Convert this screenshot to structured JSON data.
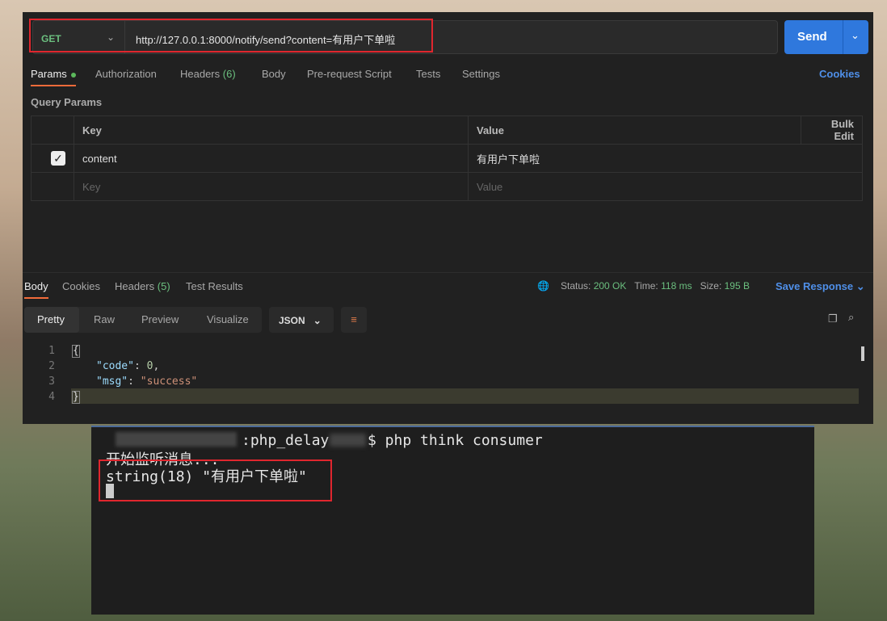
{
  "request": {
    "method": "GET",
    "url": "http://127.0.0.1:8000/notify/send?content=有用户下单啦",
    "send_label": "Send"
  },
  "tabs": [
    {
      "label": "Params"
    },
    {
      "label": "Authorization"
    },
    {
      "label": "Headers",
      "count": "(6)"
    },
    {
      "label": "Body"
    },
    {
      "label": "Pre-request Script"
    },
    {
      "label": "Tests"
    },
    {
      "label": "Settings"
    }
  ],
  "cookies_link": "Cookies",
  "query_params": {
    "title": "Query Params",
    "col_key": "Key",
    "col_value": "Value",
    "bulk_edit": "Bulk Edit",
    "rows": [
      {
        "checked": true,
        "key": "content",
        "value": "有用户下单啦"
      }
    ],
    "key_placeholder": "Key",
    "value_placeholder": "Value"
  },
  "response": {
    "tabs": [
      {
        "label": "Body"
      },
      {
        "label": "Cookies"
      },
      {
        "label": "Headers",
        "count": "(5)"
      },
      {
        "label": "Test Results"
      }
    ],
    "status_label": "Status:",
    "status": "200 OK",
    "time_label": "Time:",
    "time": "118 ms",
    "size_label": "Size:",
    "size": "195 B",
    "save": "Save Response",
    "views": [
      "Pretty",
      "Raw",
      "Preview",
      "Visualize"
    ],
    "format": "JSON",
    "lines": [
      "{",
      "    \"code\": 0,",
      "    \"msg\": \"success\"",
      "}"
    ],
    "line_numbers": [
      "1",
      "2",
      "3",
      "4"
    ],
    "code_key": "\"code\"",
    "code_val": "0",
    "msg_key": "\"msg\"",
    "msg_val": "\"success\""
  },
  "terminal": {
    "prompt": ":php_delay",
    "command": "$ php think consumer",
    "line2": "开始监听消息...",
    "line3": "string(18) \"有用户下单啦\""
  }
}
